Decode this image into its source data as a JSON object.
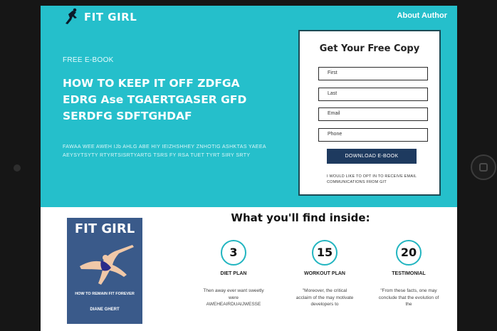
{
  "brand": {
    "name": "FIT GIRL"
  },
  "nav": {
    "about": "About Author"
  },
  "hero": {
    "eyebrow": "FREE E-BOOK",
    "headline": "HOW TO KEEP IT OFF ZDFGA EDRG Ase TGAERTGASER GFD  SERDFG SDFTGHDAF",
    "description": "FAWAA WEE AWEH IJb AHLG  ABE HIY   IEIZHSHHEY  ZNHOTIG  ASHKTAS YAEEA AEYSYTSYTY RTYRTSISRTYARTG TSRS FY RSA TUET TYRT SIRY SRTY"
  },
  "form": {
    "title": "Get Your Free Copy",
    "fields": [
      {
        "placeholder": "First"
      },
      {
        "placeholder": "Last"
      },
      {
        "placeholder": "Email"
      },
      {
        "placeholder": "Phone"
      }
    ],
    "button": "DOWNLOAD E-BOOK",
    "consent": "I WOULD LIKE TO OPT IN TO RECEIVE EMAIL COMMUNICATIONS FROM GIT"
  },
  "book": {
    "title": "FIT GIRL",
    "subtitle": "HOW TO REMAIN FIT FOREVER",
    "author": "DIANE GHERT"
  },
  "inside": {
    "title": "What you'll find inside:",
    "items": [
      {
        "number": "3",
        "label": "DIET PLAN",
        "desc": "Then away ever want sweetly were AWEHEAIRDUAIJWESSE"
      },
      {
        "number": "15",
        "label": "WORKOUT PLAN",
        "desc": "\"Moreover, the critical acclaim of the may motivate developers to"
      },
      {
        "number": "20",
        "label": "TESTIMONIAL",
        "desc": "\"From these facts, one may conclude that the evolution of the"
      }
    ]
  },
  "colors": {
    "hero_bg": "#25bfcb",
    "button_bg": "#1e3a5f",
    "accent": "#22b5c0"
  }
}
